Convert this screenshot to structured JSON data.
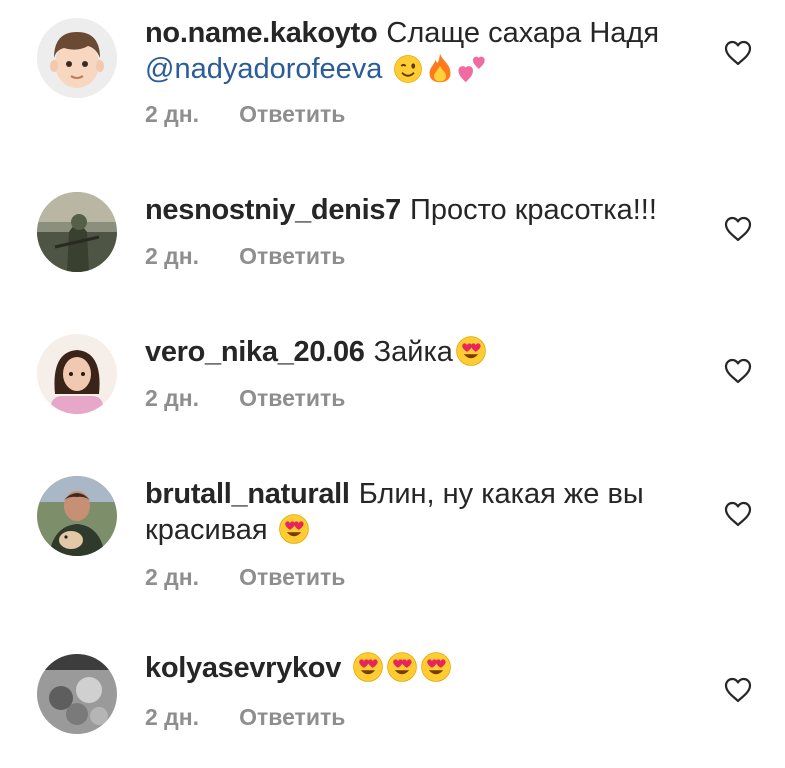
{
  "comments": [
    {
      "username": "no.name.kakoyto",
      "text_line1": "Слаще сахара Надя",
      "mention": "@nadyadorofeeva",
      "emojis": [
        "winking-face-emoji",
        "fire-emoji",
        "two-hearts-emoji"
      ],
      "time": "2 дн.",
      "reply": "Ответить",
      "avatar": "cartoon-boy-avatar"
    },
    {
      "username": "nesnostniy_denis7",
      "text": "Просто красотка!!!",
      "time": "2 дн.",
      "reply": "Ответить",
      "avatar": "soldier-photo-avatar"
    },
    {
      "username": "vero_nika_20.06",
      "text": "Зайка",
      "emojis": [
        "heart-eyes-emoji"
      ],
      "time": "2 дн.",
      "reply": "Ответить",
      "avatar": "girl-photo-avatar"
    },
    {
      "username": "brutall_naturall",
      "text_line1": "Блин, ну какая же вы",
      "text_line2": "красивая",
      "emojis": [
        "heart-eyes-emoji"
      ],
      "time": "2 дн.",
      "reply": "Ответить",
      "avatar": "man-with-dog-photo-avatar"
    },
    {
      "username": "kolyasevrykov",
      "emojis": [
        "heart-eyes-emoji",
        "heart-eyes-emoji",
        "heart-eyes-emoji"
      ],
      "time": "2 дн.",
      "reply": "Ответить",
      "avatar": "group-photo-avatar"
    }
  ],
  "colors": {
    "text": "#262626",
    "meta": "#8e8e8e",
    "mention": "#2b5c99",
    "emoji_yellow": "#ffcc33",
    "heart_pink": "#e8245c"
  },
  "icons": {
    "like": "heart-outline-icon"
  }
}
